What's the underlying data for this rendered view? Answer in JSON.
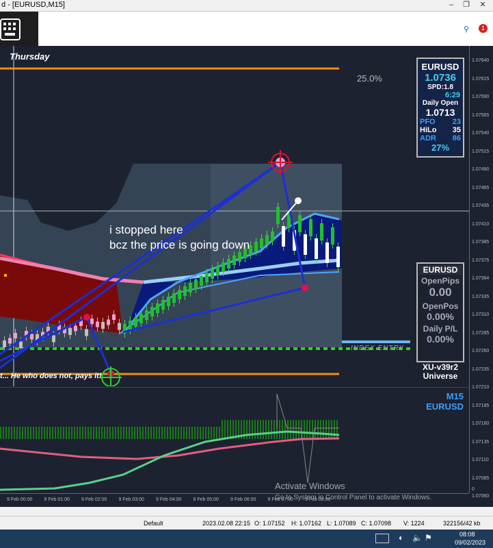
{
  "window": {
    "title": "d - [EURUSD,M15]"
  },
  "chart_labels": {
    "day": "Thursday",
    "percent": "25.0%",
    "slogan": "t... He who does not, pays it!",
    "index_entry": "INDEX ENTRY",
    "annotation_line1": "i stopped here",
    "annotation_line2": "bcz the price is going down"
  },
  "panel_top": {
    "symbol": "EURUSD",
    "price": "1.0736",
    "spd": "SPD:1.8",
    "timer": "6:29",
    "daily_open_label": "Daily Open",
    "daily_open": "1.0713",
    "pfo_label": "PFO",
    "pfo": "23",
    "hilo_label": "HiLo",
    "hilo": "35",
    "adr_label": "ADR",
    "adr": "86",
    "adr_pct": "27%"
  },
  "panel_bottom": {
    "symbol": "EURUSD",
    "openpips_label": "OpenPips",
    "openpips": "0.00",
    "openpos_label": "OpenPos",
    "openpos": "0.00%",
    "dailypl_label": "Daily P/L",
    "dailypl": "0.00%",
    "brand1": "XU-v39r2",
    "brand2": "Universe"
  },
  "subwindow": {
    "tf": "M15",
    "symbol": "EURUSD",
    "zero": "0"
  },
  "price_axis": [
    "1.07640",
    "1.07615",
    "1.07590",
    "1.07565",
    "1.07540",
    "1.07515",
    "1.07490",
    "1.07465",
    "1.07435",
    "1.07410",
    "1.07385",
    "1.07375",
    "1.07364",
    "1.07335",
    "1.07310",
    "1.07285",
    "1.07260",
    "1.07235",
    "1.07210",
    "1.07185",
    "1.07160",
    "1.07135",
    "1.07110",
    "1.07085",
    "1.07060"
  ],
  "time_axis": [
    "9 Feb 00:00",
    "9 Feb 01:00",
    "9 Feb 02:00",
    "9 Feb 03:00",
    "9 Feb 04:00",
    "9 Feb 05:00",
    "9 Feb 06:00",
    "9 Feb 07:00",
    "9 Feb 08:00"
  ],
  "status": {
    "profile": "Default",
    "time": "2023.02.08 22:15",
    "open": "O: 1.07152",
    "high": "H: 1.07162",
    "low": "L: 1.07089",
    "close": "C: 1.07098",
    "volume": "V: 1224",
    "traffic": "322156/42 kb"
  },
  "taskbar": {
    "time": "08:08",
    "date": "09/02/2023"
  },
  "watermark": {
    "line1": "Activate Windows",
    "line2": "Go to System in Control Panel to activate Windows."
  },
  "colors": {
    "bg": "#1d2230",
    "bull": "#22c02a",
    "bear": "#f0a0d0",
    "blue": "#1b2fd6",
    "lightblue": "#4aa8ff",
    "orange": "#f08c1a",
    "dkred": "#7a0a0a"
  }
}
